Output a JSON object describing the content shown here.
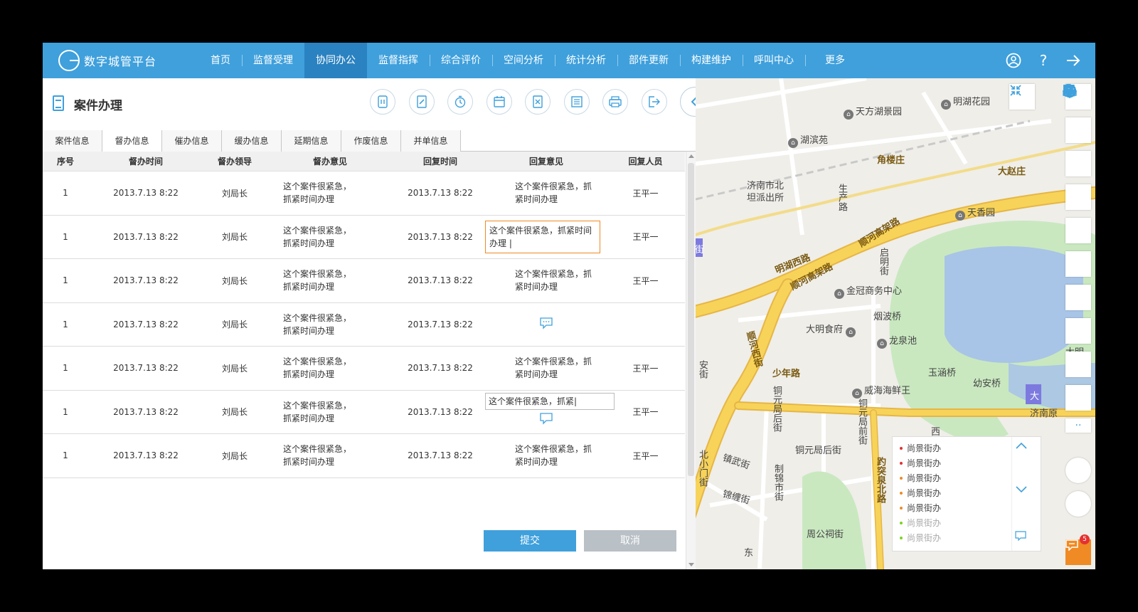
{
  "app": {
    "title": "数字城管平台",
    "nav": [
      "首页",
      "监督受理",
      "协同办公",
      "监督指挥",
      "综合评价",
      "空间分析",
      "统计分析",
      "部件更新",
      "构建维护",
      "呼叫中心",
      "更多"
    ],
    "active_nav": "协同办公",
    "icons": [
      "user-icon",
      "help-icon",
      "logout-icon"
    ]
  },
  "panel": {
    "title": "案件办理",
    "toolbar_icons": [
      "pause-icon",
      "edit-icon",
      "timer-icon",
      "calendar-icon",
      "close-file-icon",
      "list-icon",
      "print-icon",
      "exit-icon",
      "chevron-left-icon"
    ]
  },
  "tabs": [
    "案件信息",
    "督办信息",
    "催办信息",
    "缓办信息",
    "延期信息",
    "作废信息",
    "并单信息"
  ],
  "active_tab": "督办信息",
  "table": {
    "columns": [
      "序号",
      "督办时间",
      "督办领导",
      "督办意见",
      "回复时间",
      "回复意见",
      "回复人员"
    ],
    "rows": [
      {
        "no": "1",
        "time": "2013.7.13  8:22",
        "leader": "刘局长",
        "opinion": "这个案件很紧急，抓紧时间办理",
        "reply_time": "2013.7.13  8:22",
        "reply": "这个案件很紧急，抓紧时间办理",
        "replier": "王平一"
      },
      {
        "no": "1",
        "time": "2013.7.13  8:22",
        "leader": "刘局长",
        "opinion": "这个案件很紧急，抓紧时间办理",
        "reply_time": "2013.7.13  8:22",
        "reply": "这个案件很紧急，抓紧时间办理 |",
        "replier": "王平一"
      },
      {
        "no": "1",
        "time": "2013.7.13  8:22",
        "leader": "刘局长",
        "opinion": "这个案件很紧急，抓紧时间办理",
        "reply_time": "2013.7.13  8:22",
        "reply": "这个案件很紧急，抓紧时间办理",
        "replier": "王平一"
      },
      {
        "no": "1",
        "time": "2013.7.13  8:22",
        "leader": "刘局长",
        "opinion": "这个案件很紧急，抓紧时间办理",
        "reply_time": "2013.7.13  8:22",
        "reply": "",
        "replier": ""
      },
      {
        "no": "1",
        "time": "2013.7.13  8:22",
        "leader": "刘局长",
        "opinion": "这个案件很紧急，抓紧时间办理",
        "reply_time": "2013.7.13  8:22",
        "reply": "这个案件很紧急，抓紧时间办理",
        "replier": "王平一"
      },
      {
        "no": "1",
        "time": "2013.7.13  8:22",
        "leader": "刘局长",
        "opinion": "这个案件很紧急，抓紧时间办理",
        "reply_time": "2013.7.13  8:22",
        "reply": "这个案件很紧急，抓紧|",
        "replier": "王平一"
      },
      {
        "no": "1",
        "time": "2013.7.13  8:22",
        "leader": "刘局长",
        "opinion": "这个案件很紧急，抓紧时间办理",
        "reply_time": "2013.7.13  8:22",
        "reply": "这个案件很紧急，抓紧时间办理",
        "replier": "王平一"
      }
    ]
  },
  "buttons": {
    "submit": "提交",
    "cancel": "取消"
  },
  "map": {
    "labels": [
      "天方湖景园",
      "明湖花园",
      "湖滨苑",
      "角楼庄",
      "大赵庄",
      "济南市北",
      "坦派出所",
      "生产路",
      "天香园",
      "明湖西路",
      "顺河高架路",
      "金冠商务中心",
      "烟波桥",
      "大明食府",
      "龙泉池",
      "顺河西街",
      "少年路",
      "玉涵桥",
      "幼安桥",
      "威海海鲜王",
      "铜元局后街",
      "铜元局前街",
      "济南原",
      "西",
      "镇武街",
      "制锦市街",
      "铜元局后街",
      "北小门街",
      "锦缠街",
      "趵突泉北路",
      "周公祠街",
      "东",
      "启明街",
      "大明",
      "大",
      "安街",
      "街"
    ],
    "notifications": [
      {
        "text": "尚景街办",
        "color": "#e53030"
      },
      {
        "text": "尚景街办",
        "color": "#e53030"
      },
      {
        "text": "尚景街办",
        "color": "#f08a24"
      },
      {
        "text": "尚景街办",
        "color": "#f08a24"
      },
      {
        "text": "尚景街办",
        "color": "#f08a24"
      },
      {
        "text": "尚景街办",
        "color": "#7ed321"
      },
      {
        "text": "尚景街办",
        "color": "#7ed321"
      }
    ],
    "chat_badge": "5"
  },
  "colors": {
    "primary": "#3fa0dc",
    "active_nav": "#2b82c0",
    "accent": "#f08a24",
    "road": "#f7d35a",
    "water": "#a8c4e6",
    "park": "#c9e8c0"
  }
}
